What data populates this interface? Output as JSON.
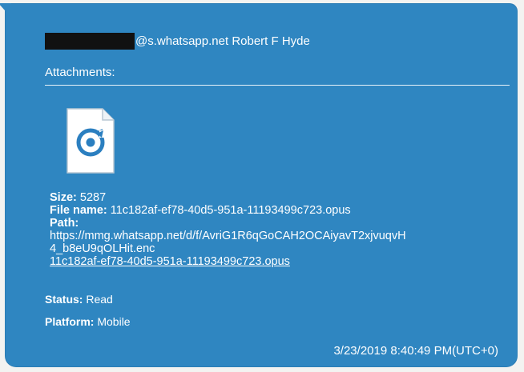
{
  "message": {
    "sender_suffix": "@s.whatsapp.net",
    "sender_name": "Robert F Hyde",
    "attachments_label": "Attachments:",
    "attachment": {
      "icon": "audio-file-icon",
      "size_label": "Size:",
      "size_value": "5287",
      "file_name_label": "File name:",
      "file_name_value": "11c182af-ef78-40d5-951a-11193499c723.opus",
      "path_label": "Path:",
      "path_line1": "https://mmg.whatsapp.net/d/f/AvriG1R6qGoCAH2OCAiyavT2xjvuqvH",
      "path_line2": "4_b8eU9qOLHit.enc",
      "link_text": "11c182af-ef78-40d5-951a-11193499c723.opus"
    },
    "status_label": "Status:",
    "status_value": "Read",
    "platform_label": "Platform:",
    "platform_value": "Mobile",
    "timestamp": "3/23/2019 8:40:49 PM(UTC+0)"
  },
  "colors": {
    "bubble": "#2f86c1",
    "text": "#ffffff",
    "redaction": "#111111"
  }
}
